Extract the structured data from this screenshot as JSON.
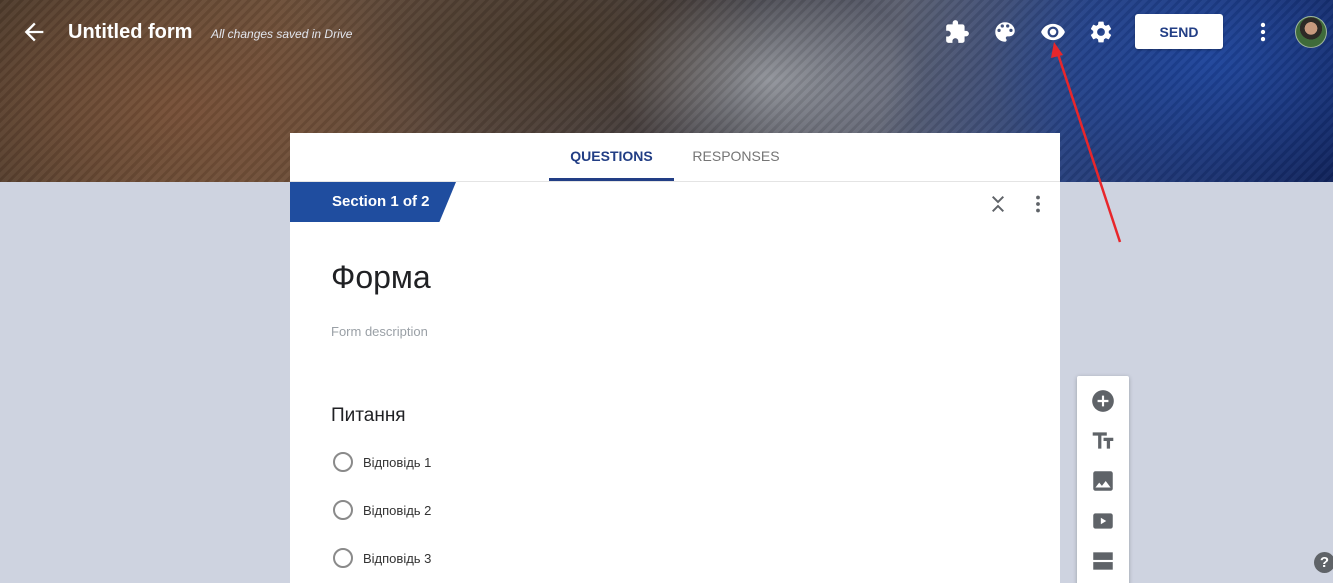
{
  "header": {
    "title": "Untitled form",
    "save_status": "All changes saved in Drive",
    "send_label": "SEND",
    "icons": [
      "back-arrow-icon",
      "addons-puzzle-icon",
      "palette-icon",
      "preview-eye-icon",
      "settings-gear-icon",
      "more-vert-icon"
    ]
  },
  "tabs": [
    {
      "label": "QUESTIONS",
      "active": true
    },
    {
      "label": "RESPONSES",
      "active": false
    }
  ],
  "section": {
    "label": "Section 1 of 2"
  },
  "form": {
    "title": "Форма",
    "description_placeholder": "Form description"
  },
  "question": {
    "title": "Питання",
    "options": [
      "Відповідь 1",
      "Відповідь 2",
      "Відповідь 3"
    ]
  },
  "toolbar": {
    "tools": [
      "add-question-icon",
      "add-title-icon",
      "add-image-icon",
      "add-video-icon",
      "add-section-icon"
    ]
  },
  "help": {
    "label": "?"
  },
  "colors": {
    "accent": "#223e85",
    "section_banner": "#1f4d9f",
    "page_background": "#ced3e0",
    "annotation_arrow": "#e8262b"
  }
}
